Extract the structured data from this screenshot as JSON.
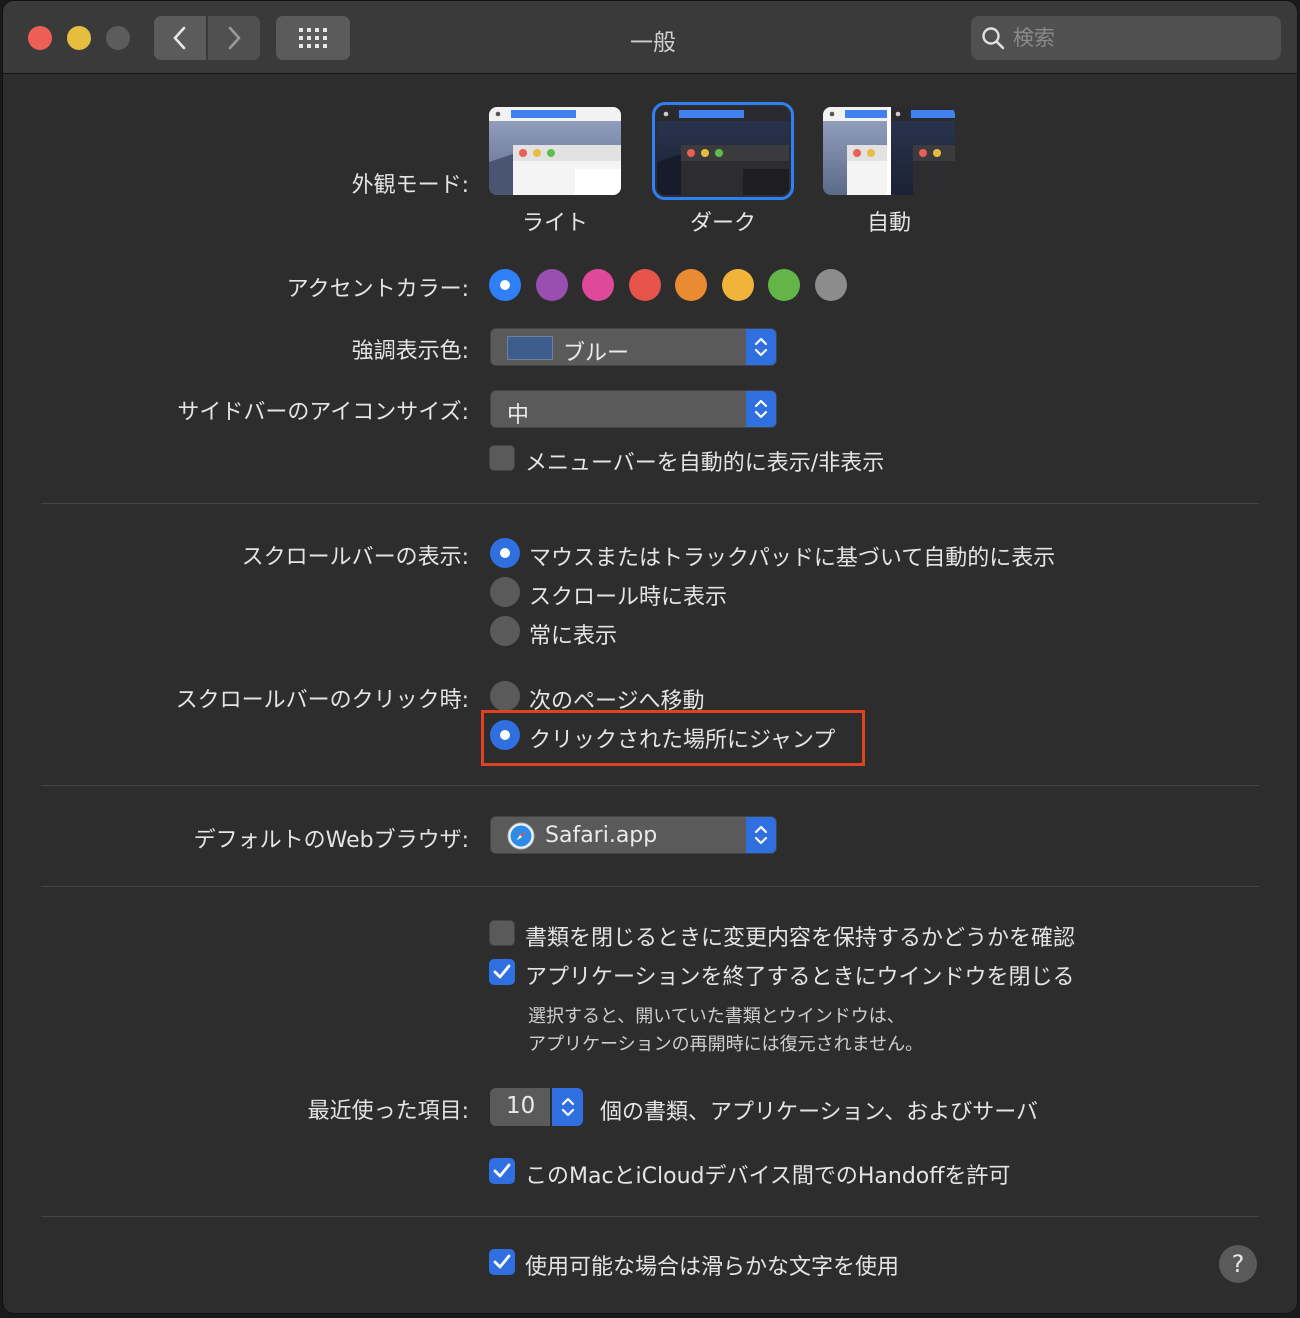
{
  "window": {
    "title": "一般",
    "search_placeholder": "検索"
  },
  "appearance": {
    "label": "外観モード:",
    "options": [
      "ライト",
      "ダーク",
      "自動"
    ],
    "selected": "ダーク"
  },
  "accent": {
    "label": "アクセントカラー:",
    "colors": [
      "#2f7ff7",
      "#9a4fb0",
      "#e0489a",
      "#e5534b",
      "#ea8b34",
      "#f0b43a",
      "#63b547",
      "#8c8c8c"
    ],
    "selected_index": 0
  },
  "highlight_color": {
    "label": "強調表示色:",
    "value": "ブルー"
  },
  "sidebar_icon_size": {
    "label": "サイドバーのアイコンサイズ:",
    "value": "中"
  },
  "menubar_autohide": {
    "label": "メニューバーを自動的に表示/非表示",
    "checked": false
  },
  "scrollbars": {
    "label": "スクロールバーの表示:",
    "options": [
      "マウスまたはトラックパッドに基づいて自動的に表示",
      "スクロール時に表示",
      "常に表示"
    ],
    "selected_index": 0
  },
  "scroll_click": {
    "label": "スクロールバーのクリック時:",
    "options": [
      "次のページへ移動",
      "クリックされた場所にジャンプ"
    ],
    "selected_index": 1
  },
  "browser": {
    "label": "デフォルトのWebブラウザ:",
    "value": "Safari.app"
  },
  "docs": {
    "ask_keep_changes": "書類を閉じるときに変更内容を保持するかどうかを確認",
    "ask_keep_changes_checked": false,
    "close_windows": "アプリケーションを終了するときにウインドウを閉じる",
    "close_windows_checked": true,
    "note_line1": "選択すると、開いていた書類とウインドウは、",
    "note_line2": "アプリケーションの再開時には復元されません。"
  },
  "recent": {
    "label": "最近使った項目:",
    "value": "10",
    "suffix": "個の書類、アプリケーション、およびサーバ"
  },
  "handoff": {
    "label": "このMacとiCloudデバイス間でのHandoffを許可",
    "checked": true
  },
  "font_smoothing": {
    "label": "使用可能な場合は滑らかな文字を使用",
    "checked": true
  },
  "help": {
    "label": "?"
  }
}
